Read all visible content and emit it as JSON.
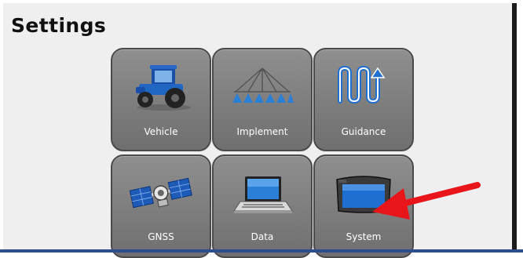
{
  "page": {
    "title": "Settings"
  },
  "tiles": [
    {
      "label": "Vehicle",
      "icon": "tractor-icon"
    },
    {
      "label": "Implement",
      "icon": "sprayer-boom-icon"
    },
    {
      "label": "Guidance",
      "icon": "guidance-pattern-icon"
    },
    {
      "label": "GNSS",
      "icon": "satellite-icon"
    },
    {
      "label": "Data",
      "icon": "laptop-icon"
    },
    {
      "label": "System",
      "icon": "display-unit-icon"
    }
  ],
  "colors": {
    "tile": "#7c7c7c",
    "accent_blue": "#1e6fd0",
    "arrow": "#e8161b"
  }
}
